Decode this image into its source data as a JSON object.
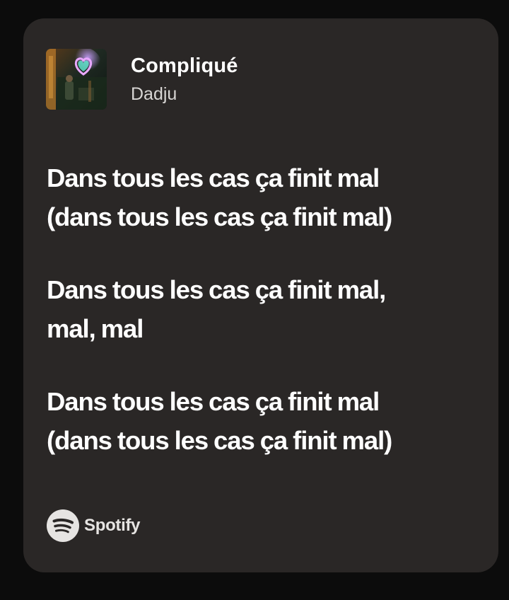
{
  "track": {
    "title": "Compliqué",
    "artist": "Dadju",
    "cover_icon": "album-cover-art"
  },
  "lyrics": {
    "stanzas": [
      [
        "Dans tous les cas ça finit mal",
        "(dans tous les cas ça finit mal)"
      ],
      [
        "Dans tous les cas ça finit mal,",
        "mal, mal"
      ],
      [
        "Dans tous les cas ça finit mal",
        "(dans tous les cas ça finit mal)"
      ]
    ]
  },
  "brand": {
    "name": "Spotify",
    "icon": "spotify-logo-icon"
  },
  "colors": {
    "page_background": "#0c0c0c",
    "card_background": "#2a2726",
    "text_primary": "#ffffff",
    "text_secondary": "#d8d6d4"
  }
}
